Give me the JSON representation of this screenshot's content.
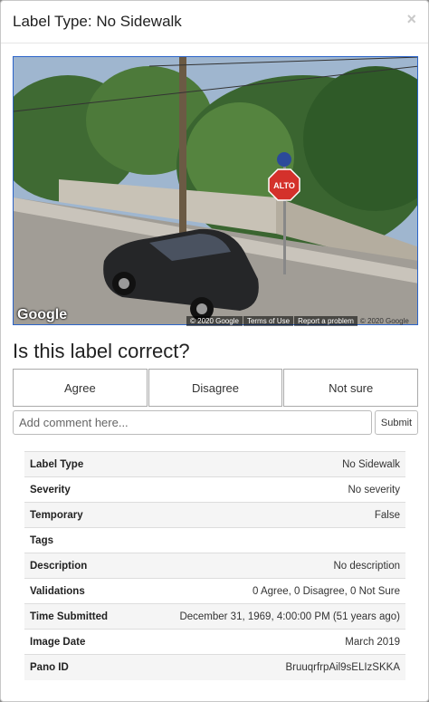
{
  "modal": {
    "title": "Label Type: No Sidewalk",
    "close_label": "×"
  },
  "pano": {
    "google_logo": "Google",
    "footer": {
      "copyright": "© 2020 Google",
      "terms": "Terms of Use",
      "report": "Report a problem",
      "copyright2": "© 2020 Google"
    },
    "sign_text": "ALTO"
  },
  "question": "Is this label correct?",
  "votes": {
    "agree": "Agree",
    "disagree": "Disagree",
    "not_sure": "Not sure"
  },
  "comment": {
    "placeholder": "Add comment here...",
    "submit": "Submit"
  },
  "info": {
    "rows": [
      {
        "key": "Label Type",
        "value": "No Sidewalk"
      },
      {
        "key": "Severity",
        "value": "No severity"
      },
      {
        "key": "Temporary",
        "value": "False"
      },
      {
        "key": "Tags",
        "value": ""
      },
      {
        "key": "Description",
        "value": "No description"
      },
      {
        "key": "Validations",
        "value": "0 Agree, 0 Disagree, 0 Not Sure"
      },
      {
        "key": "Time Submitted",
        "value": "December 31, 1969, 4:00:00 PM (51 years ago)"
      },
      {
        "key": "Image Date",
        "value": "March 2019"
      },
      {
        "key": "Pano ID",
        "value": "BruuqrfrpAil9sELIzSKKA"
      }
    ]
  },
  "colors": {
    "pano_border": "#2b64c9",
    "stop_sign": "#d4312b"
  }
}
